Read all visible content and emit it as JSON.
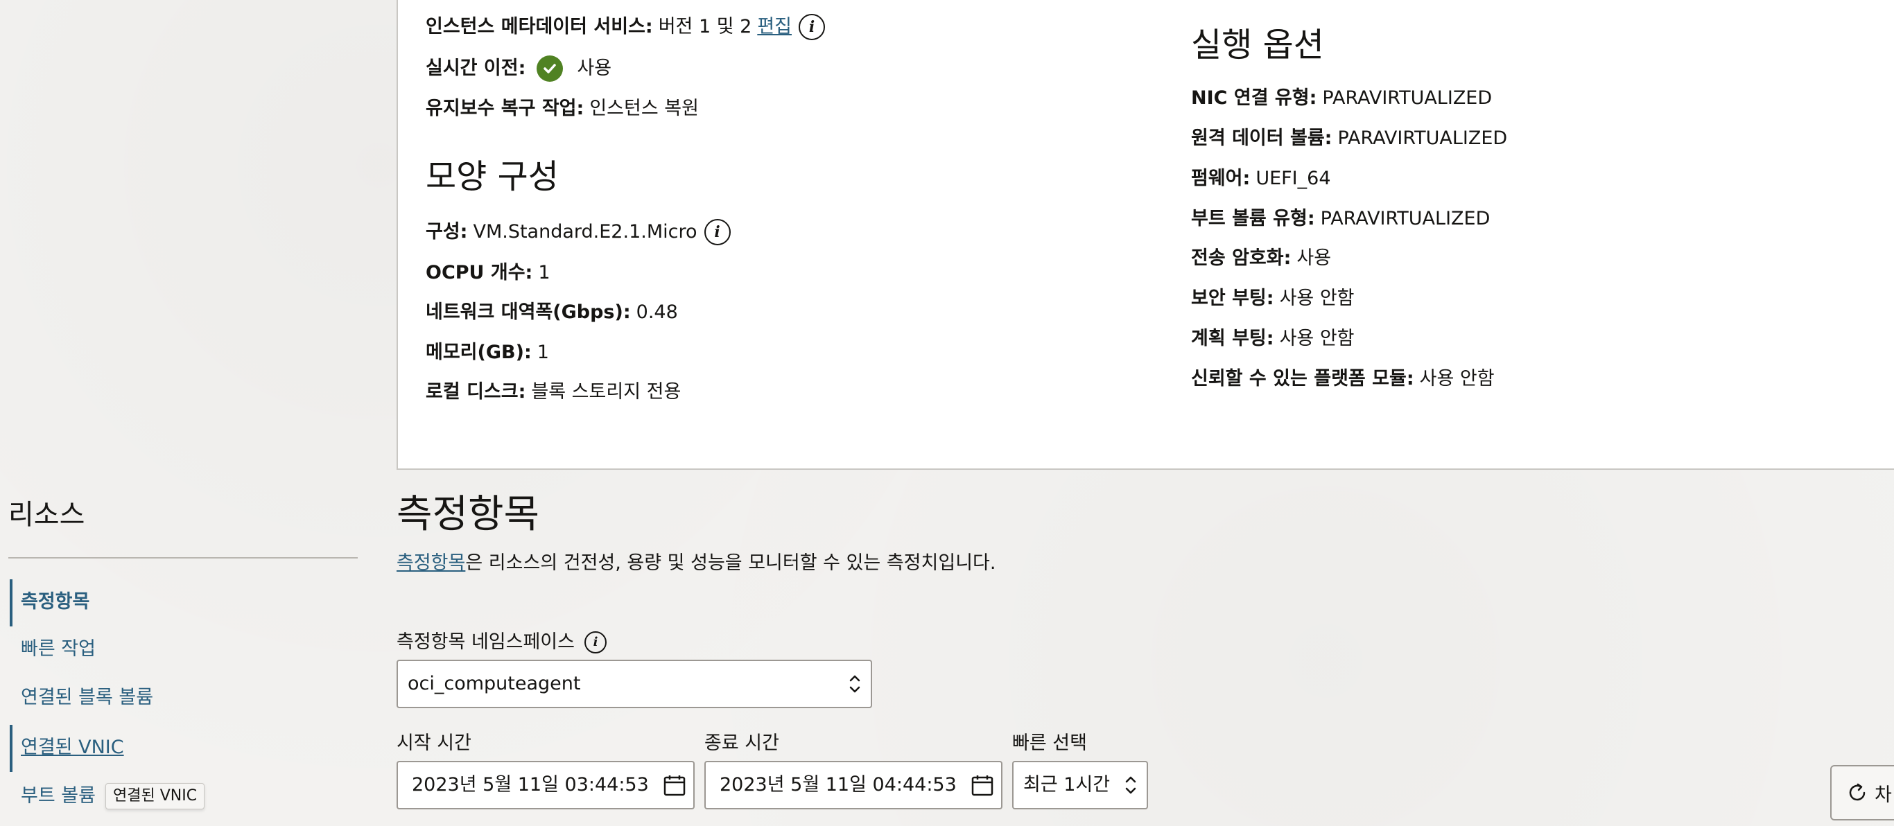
{
  "details": {
    "meta_service_label": "인스턴스 메타데이터 서비스:",
    "meta_service_value": "버전 1 및 2",
    "meta_service_edit": "편집",
    "live_migration_label": "실시간 이전:",
    "live_migration_value": "사용",
    "maintenance_label": "유지보수 복구 작업:",
    "maintenance_value": "인스턴스 복원",
    "shape_title": "모양 구성",
    "shape_label": "구성:",
    "shape_value": "VM.Standard.E2.1.Micro",
    "ocpu_label": "OCPU 개수:",
    "ocpu_value": "1",
    "bandwidth_label": "네트워크 대역폭(Gbps):",
    "bandwidth_value": "0.48",
    "memory_label": "메모리(GB):",
    "memory_value": "1",
    "local_disk_label": "로컬 디스크:",
    "local_disk_value": "블록 스토리지 전용",
    "launch_title": "실행 옵션",
    "nic_label": "NIC 연결 유형:",
    "nic_value": "PARAVIRTUALIZED",
    "remote_volume_label": "원격 데이터 볼륨:",
    "remote_volume_value": "PARAVIRTUALIZED",
    "firmware_label": "펌웨어:",
    "firmware_value": "UEFI_64",
    "boot_volume_type_label": "부트 볼륨 유형:",
    "boot_volume_type_value": "PARAVIRTUALIZED",
    "transit_enc_label": "전송 암호화:",
    "transit_enc_value": "사용",
    "secure_boot_label": "보안 부팅:",
    "secure_boot_value": "사용 안함",
    "measured_boot_label": "계획 부팅:",
    "measured_boot_value": "사용 안함",
    "tpm_label": "신뢰할 수 있는 플랫폼 모듈:",
    "tpm_value": "사용 안함"
  },
  "sidebar": {
    "title": "리소스",
    "items": [
      {
        "label": "측정항목"
      },
      {
        "label": "빠른 작업"
      },
      {
        "label": "연결된 블록 볼륨"
      },
      {
        "label": "연결된 VNIC"
      },
      {
        "label": "부트 볼륨"
      }
    ],
    "tooltip": "연결된 VNIC"
  },
  "metrics": {
    "title": "측정항목",
    "desc_link": "측정항목",
    "desc_rest": "은 리소스의 건전성, 용량 및 성능을 모니터할 수 있는 측정치입니다.",
    "namespace_label": "측정항목 네임스페이스",
    "namespace_value": "oci_computeagent",
    "start_label": "시작 시간",
    "start_value": "2023년 5월 11일 03:44:53 U",
    "end_label": "종료 시간",
    "end_value": "2023년 5월 11일 04:44:53 U",
    "quick_label": "빠른 선택",
    "quick_value": "최근 1시간",
    "refresh_label": "차"
  },
  "colors": {
    "link": "#2a5f7f",
    "check": "#508223"
  }
}
